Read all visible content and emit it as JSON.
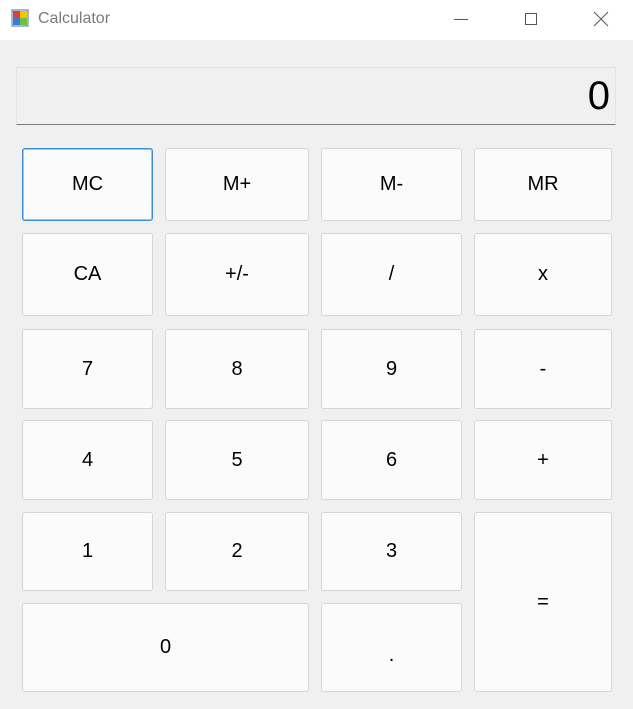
{
  "window": {
    "title": "Calculator",
    "controls": {
      "minimize": "minimize-icon",
      "maximize": "maximize-icon",
      "close": "close-icon"
    }
  },
  "display": {
    "value": "0"
  },
  "memory_row": {
    "mc": "MC",
    "mplus": "M+",
    "mminus": "M-",
    "mr": "MR"
  },
  "function_row": {
    "ca": "CA",
    "negate": "+/-",
    "divide": "/",
    "multiply": "x"
  },
  "keys": {
    "seven": "7",
    "eight": "8",
    "nine": "9",
    "minus": "-",
    "four": "4",
    "five": "5",
    "six": "6",
    "plus": "+",
    "one": "1",
    "two": "2",
    "three": "3",
    "equals": "=",
    "zero": "0",
    "decimal": "."
  },
  "colors": {
    "focus_border": "#3a8ed6",
    "background": "#f0f0f0",
    "button_background": "#fbfbfb"
  }
}
